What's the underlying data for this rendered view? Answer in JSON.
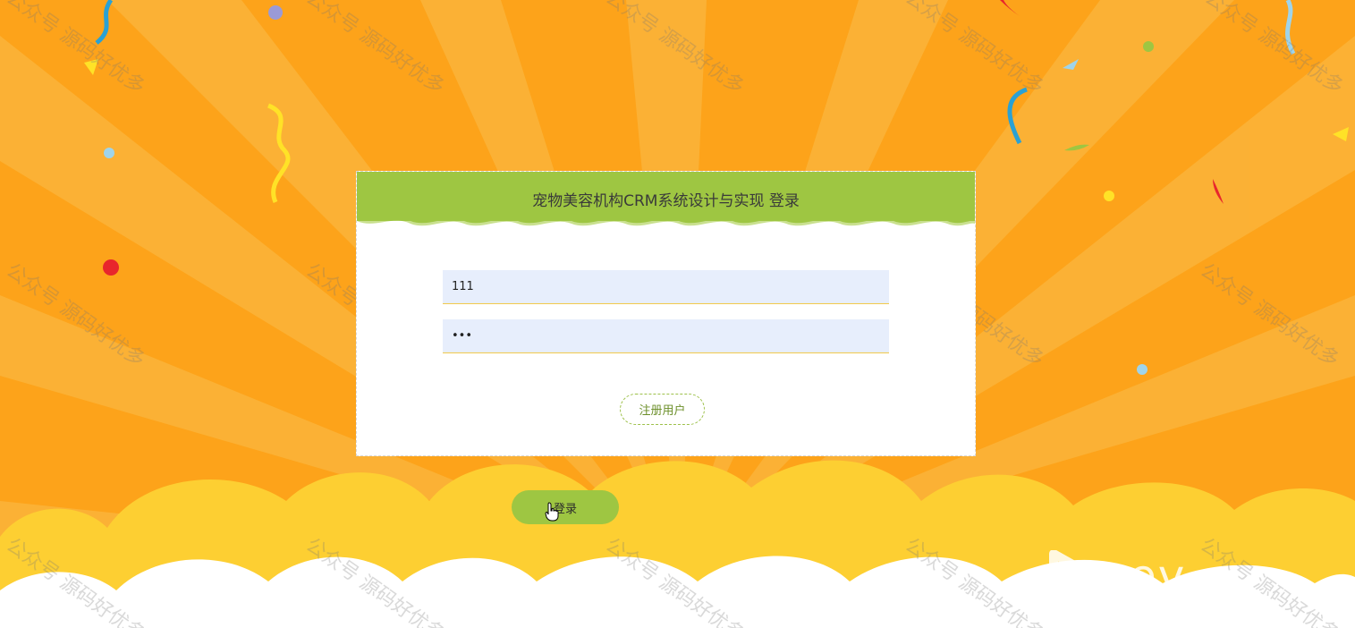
{
  "login_panel": {
    "title": "宠物美容机构CRM系统设计与实现 登录",
    "username_value": "111",
    "password_value": "•••",
    "register_label": "注册用户"
  },
  "login_button_label": "登录",
  "watermark_text": "公众号 源码好优多",
  "player_logo_text": "ev"
}
